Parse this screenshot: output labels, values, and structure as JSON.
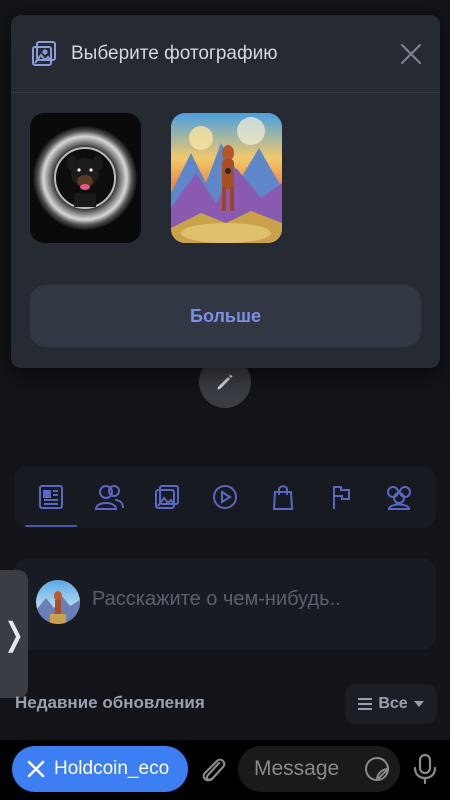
{
  "modal": {
    "title": "Выберите фотографию",
    "photos": [
      {
        "name": "rottweiler-coin-photo"
      },
      {
        "name": "dog-on-coins-mountain-photo"
      }
    ],
    "more_label": "Больше"
  },
  "tabs": [
    "news-feed-icon",
    "friends-icon",
    "photos-icon",
    "video-icon",
    "shop-icon",
    "flag-icon",
    "groups-icon"
  ],
  "composer": {
    "placeholder": "Расскажите о чем-нибудь.."
  },
  "recent": {
    "title": "Недавние обновления",
    "filter_label": "Все"
  },
  "bottom_bar": {
    "chip_label": "Holdcoin_eco",
    "message_placeholder": "Message"
  },
  "colors": {
    "accent": "#7f8de4",
    "chip": "#3d7ef3",
    "modal_bg": "#262a33",
    "page_bg": "#121419"
  }
}
